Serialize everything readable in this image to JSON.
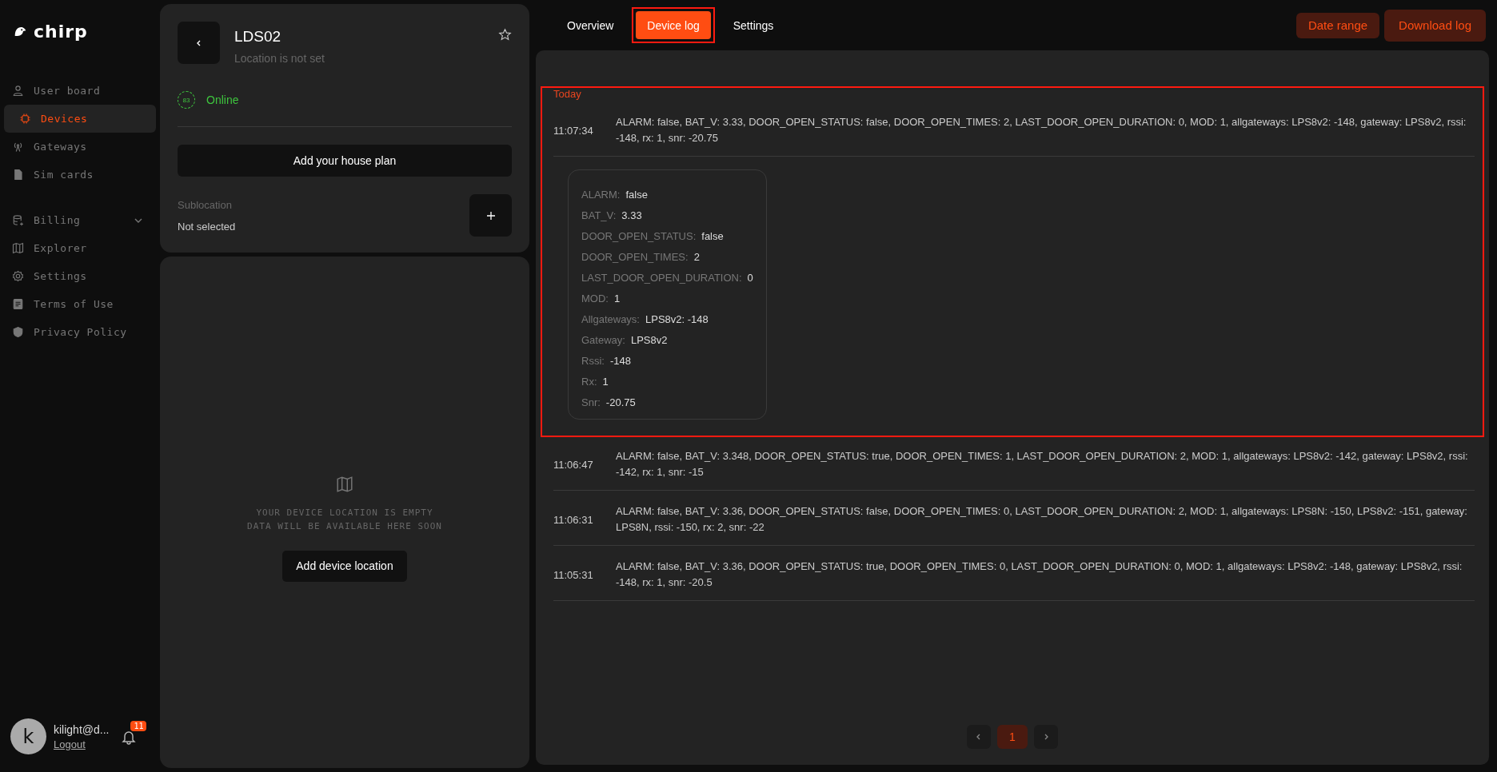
{
  "sidebar": {
    "logo": "chirp",
    "items": [
      {
        "label": "User board",
        "selected": false
      },
      {
        "label": "Devices",
        "selected": true
      },
      {
        "label": "Gateways",
        "selected": false
      },
      {
        "label": "Sim cards",
        "selected": false
      },
      {
        "label": "Billing",
        "selected": false,
        "expanded": false
      },
      {
        "label": "Explorer",
        "selected": false
      },
      {
        "label": "Settings",
        "selected": false
      },
      {
        "label": "Terms of Use",
        "selected": false
      },
      {
        "label": "Privacy Policy",
        "selected": false
      }
    ],
    "user": {
      "avatar": "k",
      "name": "kilight@d...",
      "logout": "Logout",
      "notifications": "11"
    }
  },
  "device": {
    "title": "LDS02",
    "subtitle": "Location is not set",
    "favorite": false,
    "signal": "83",
    "status": "Online",
    "house_plan_button": "Add your house plan",
    "sublocation_label": "Sublocation",
    "sublocation_value": "Not selected"
  },
  "location": {
    "empty_lines": [
      "YOUR DEVICE LOCATION IS EMPTY",
      "DATA WILL BE AVAILABLE HERE SOON"
    ],
    "button": "Add device location"
  },
  "tabs": [
    {
      "label": "Overview",
      "selected": false,
      "highlighted": false
    },
    {
      "label": "Device log",
      "selected": true,
      "highlighted": true
    },
    {
      "label": "Settings",
      "selected": false,
      "highlighted": false
    }
  ],
  "actions": [
    "Date range",
    "Download log"
  ],
  "log": {
    "day": "Today",
    "entries": [
      {
        "time": "11:07:34",
        "text": "ALARM: false, BAT_V: 3.33, DOOR_OPEN_STATUS: false, DOOR_OPEN_TIMES: 2, LAST_DOOR_OPEN_DURATION: 0, MOD: 1, allgateways: LPS8v2: -148, gateway: LPS8v2, rssi: -148, rx: 1, snr: -20.75",
        "highlighted": true,
        "details": [
          {
            "key": "ALARM:",
            "value": "false"
          },
          {
            "key": "BAT_V:",
            "value": "3.33"
          },
          {
            "key": "DOOR_OPEN_STATUS:",
            "value": "false"
          },
          {
            "key": "DOOR_OPEN_TIMES:",
            "value": "2"
          },
          {
            "key": "LAST_DOOR_OPEN_DURATION:",
            "value": "0"
          },
          {
            "key": "MOD:",
            "value": "1"
          },
          {
            "key": "Allgateways:",
            "value": "LPS8v2: -148"
          },
          {
            "key": "Gateway:",
            "value": "LPS8v2"
          },
          {
            "key": "Rssi:",
            "value": "-148"
          },
          {
            "key": "Rx:",
            "value": "1"
          },
          {
            "key": "Snr:",
            "value": "-20.75"
          }
        ]
      },
      {
        "time": "11:06:47",
        "text": "ALARM: false, BAT_V: 3.348, DOOR_OPEN_STATUS: true, DOOR_OPEN_TIMES: 1, LAST_DOOR_OPEN_DURATION: 2, MOD: 1, allgateways: LPS8v2: -142, gateway: LPS8v2, rssi: -142, rx: 1, snr: -15",
        "highlighted": false
      },
      {
        "time": "11:06:31",
        "text": "ALARM: false, BAT_V: 3.36, DOOR_OPEN_STATUS: false, DOOR_OPEN_TIMES: 0, LAST_DOOR_OPEN_DURATION: 2, MOD: 1, allgateways: LPS8N: -150, LPS8v2: -151, gateway: LPS8N, rssi: -150, rx: 2, snr: -22",
        "highlighted": false
      },
      {
        "time": "11:05:31",
        "text": "ALARM: false, BAT_V: 3.36, DOOR_OPEN_STATUS: true, DOOR_OPEN_TIMES: 0, LAST_DOOR_OPEN_DURATION: 0, MOD: 1, allgateways: LPS8v2: -148, gateway: LPS8v2, rssi: -148, rx: 1, snr: -20.5",
        "highlighted": false
      }
    ]
  },
  "pagination": {
    "pages": [
      {
        "label": "1",
        "selected": true
      }
    ]
  }
}
